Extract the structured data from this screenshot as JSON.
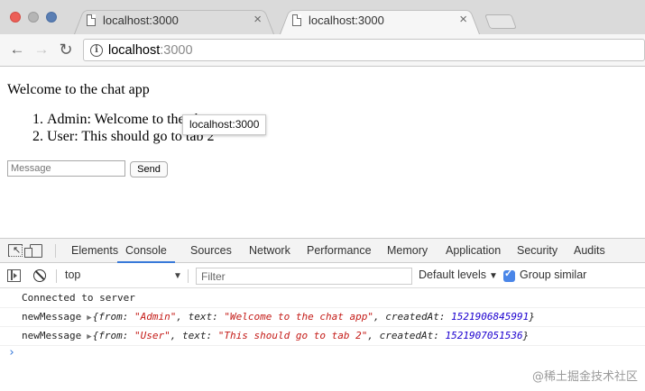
{
  "browser": {
    "tabs": [
      {
        "title": "localhost:3000",
        "active": false
      },
      {
        "title": "localhost:3000",
        "active": true
      }
    ],
    "close_glyph": "×",
    "url_host": "localhost",
    "url_port": ":3000",
    "info_glyph": "i",
    "back_glyph": "←",
    "forward_glyph": "→",
    "reload_glyph": "↻"
  },
  "page": {
    "welcome": "Welcome to the chat app",
    "messages": [
      {
        "num": "1.",
        "text": "Admin: Welcome to the chat app"
      },
      {
        "num": "2.",
        "text": "User: This should go to tab 2"
      }
    ],
    "tooltip": "localhost:3000",
    "message_placeholder": "Message",
    "send_label": "Send"
  },
  "devtools": {
    "tabs": [
      "Elements",
      "Console",
      "Sources",
      "Network",
      "Performance",
      "Memory",
      "Application",
      "Security",
      "Audits"
    ],
    "active_tab": "Console",
    "context": "top",
    "context_arrow": "▼",
    "filter_placeholder": "Filter",
    "levels_label": "Default levels",
    "levels_arrow": "▼",
    "group_similar_label": "Group similar",
    "group_similar_checked": true,
    "accent_color": "#3879d9",
    "log": [
      {
        "plain": "Connected to server"
      },
      {
        "label": "newMessage",
        "from": "Admin",
        "text": "Welcome to the chat app",
        "createdAt": "1521906845991"
      },
      {
        "label": "newMessage",
        "from": "User",
        "text": "This should go to tab 2",
        "createdAt": "1521907051536"
      }
    ],
    "prompt_glyph": "›"
  },
  "watermark": "@稀土掘金技术社区"
}
